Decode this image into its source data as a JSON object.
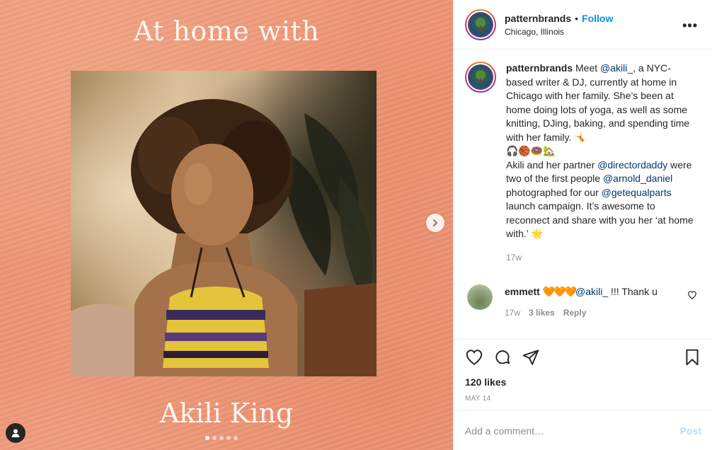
{
  "media": {
    "title": "At home with",
    "name": "Akili King",
    "slide_count": 5,
    "active_slide": 1
  },
  "header": {
    "username": "patternbrands",
    "separator": "•",
    "follow_label": "Follow",
    "location": "Chicago, Illinois",
    "more": "•••"
  },
  "caption": {
    "username": "patternbrands",
    "text_1": " Meet ",
    "mention_1": "@akili_",
    "text_2": ", a NYC-based writer & DJ, currently at home in Chicago with her family. She’s been at home doing lots of yoga, as well as some knitting, DJing, baking, and spending time with her family. 🤸",
    "emoji_line": "🎧🏀🍩🏡",
    "text_3": "Akili and her partner ",
    "mention_2": "@directordaddy",
    "text_4": " were two of the first people ",
    "mention_3": "@arnold_daniel",
    "text_5": " photographed for our ",
    "mention_4": "@getequalparts",
    "text_6": " launch campaign. It’s awesome to reconnect and share with you her ‘at home with.’ 🌟",
    "time": "17w"
  },
  "comment": {
    "username": "emmett",
    "hearts": "🧡🧡🧡",
    "mention": "@akili_",
    "text": " !!! Thank u",
    "time": "17w",
    "likes": "3 likes",
    "reply": "Reply"
  },
  "actions": {
    "likes": "120 likes",
    "date": "MAY 14"
  },
  "add_comment": {
    "placeholder": "Add a comment…",
    "post": "Post"
  },
  "colors": {
    "accent": "#0095f6",
    "mention": "#00376b",
    "muted": "#8e8e8e",
    "post_disabled": "#b2dffc",
    "background_peach": "#ec906f"
  }
}
